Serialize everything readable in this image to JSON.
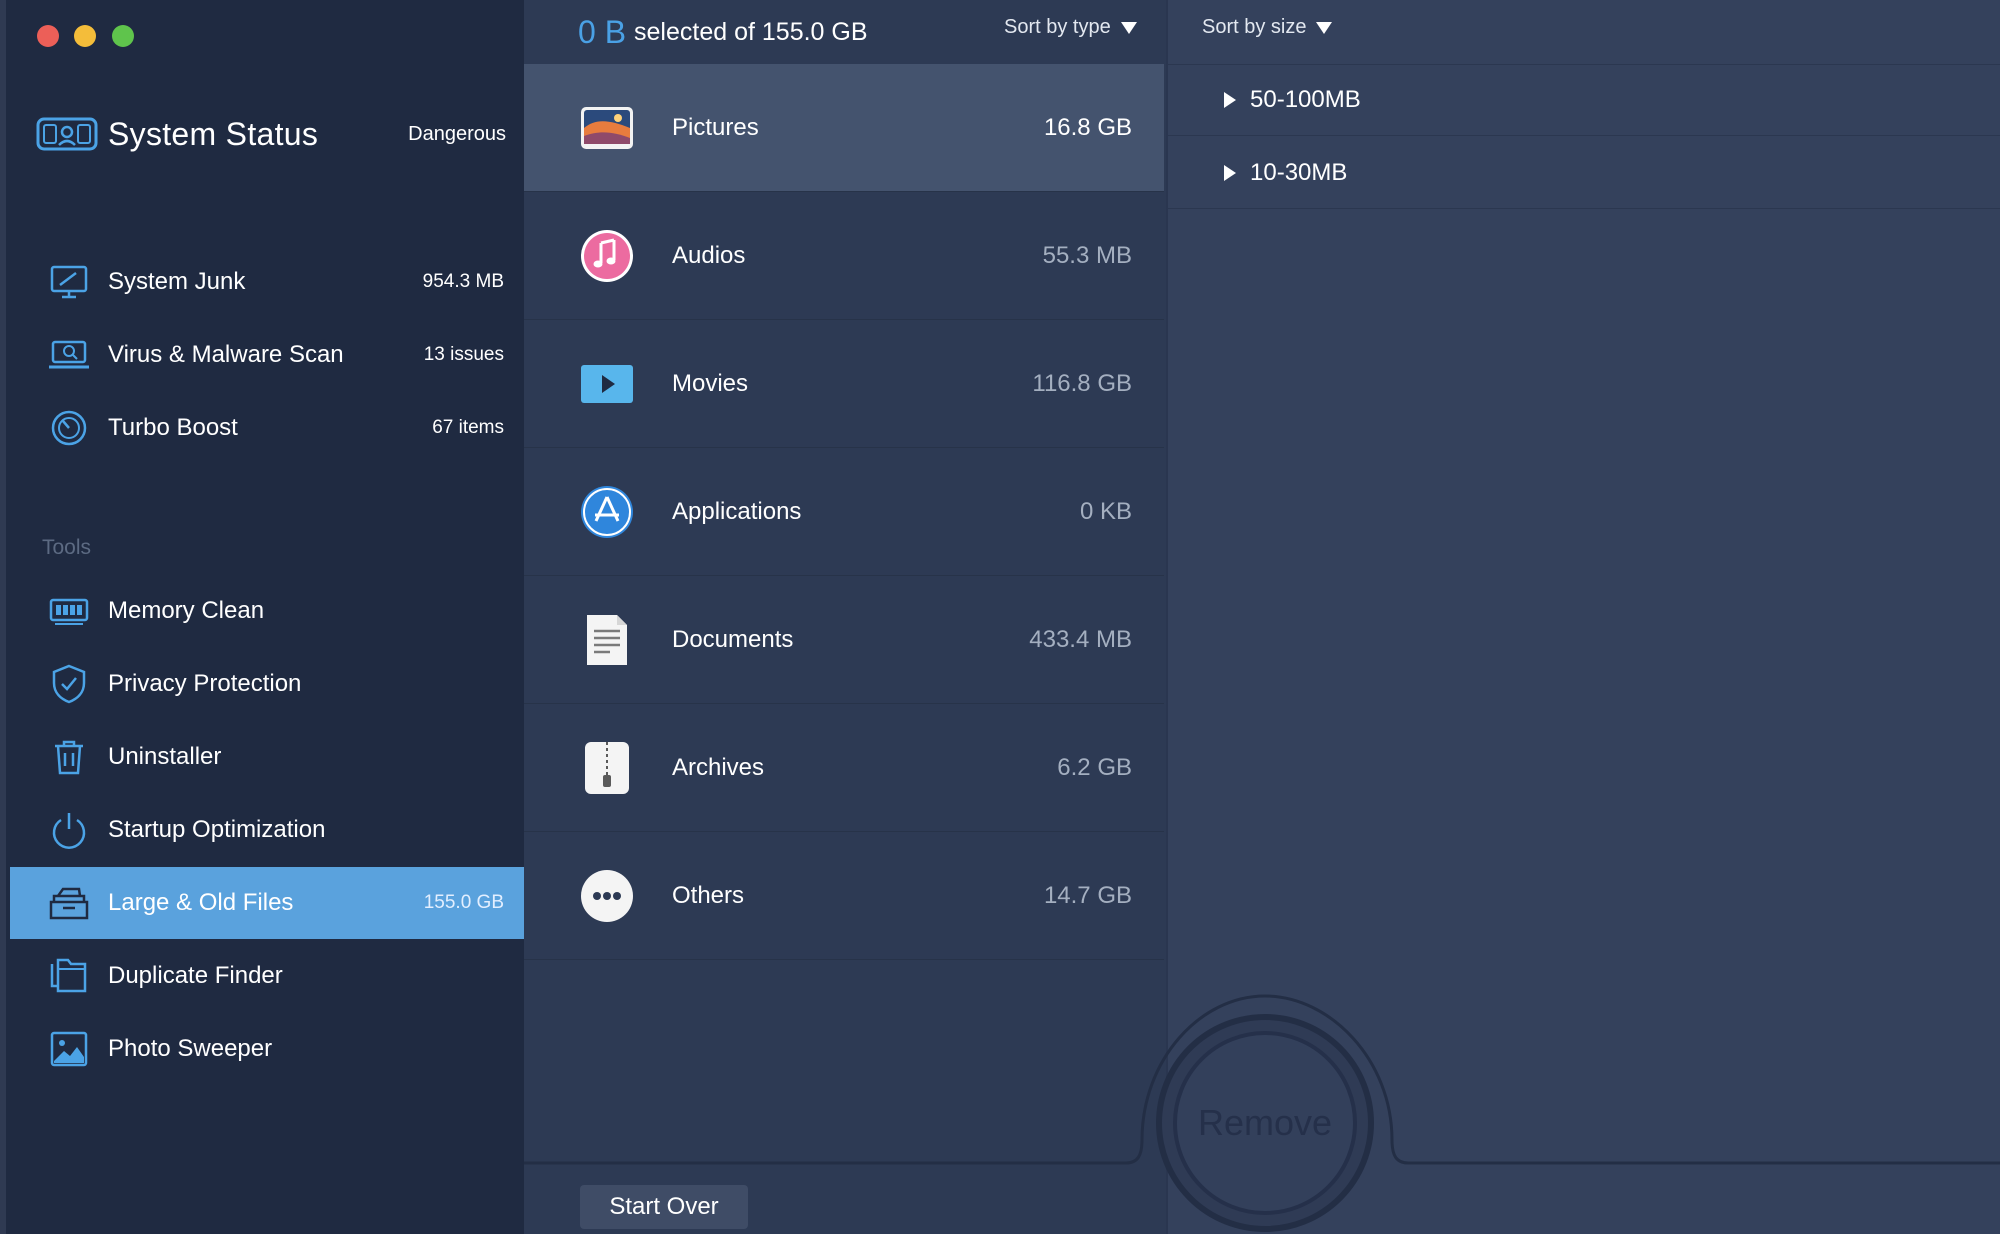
{
  "window": {
    "traffic_lights": [
      "close",
      "minimize",
      "zoom"
    ]
  },
  "sidebar": {
    "status": {
      "title": "System Status",
      "value": "Dangerous",
      "icon": "system-status-icon"
    },
    "items": [
      {
        "label": "System Junk",
        "value": "954.3 MB",
        "icon": "monitor-icon"
      },
      {
        "label": "Virus & Malware Scan",
        "value": "13 issues",
        "icon": "laptop-scan-icon"
      },
      {
        "label": "Turbo Boost",
        "value": "67 items",
        "icon": "speedometer-icon"
      }
    ],
    "tools_header": "Tools",
    "tools": [
      {
        "label": "Memory Clean",
        "value": "",
        "icon": "memory-icon"
      },
      {
        "label": "Privacy Protection",
        "value": "",
        "icon": "shield-icon"
      },
      {
        "label": "Uninstaller",
        "value": "",
        "icon": "trash-icon"
      },
      {
        "label": "Startup Optimization",
        "value": "",
        "icon": "power-icon"
      },
      {
        "label": "Large & Old Files",
        "value": "155.0 GB",
        "icon": "file-box-icon",
        "active": true
      },
      {
        "label": "Duplicate Finder",
        "value": "",
        "icon": "duplicate-icon"
      },
      {
        "label": "Photo Sweeper",
        "value": "",
        "icon": "photo-icon"
      }
    ]
  },
  "middle": {
    "selected_amount": "0 B",
    "selected_text": "selected of 155.0 GB",
    "sort_type_label": "Sort by type",
    "categories": [
      {
        "label": "Pictures",
        "size": "16.8 GB",
        "icon": "pictures-icon",
        "active": true
      },
      {
        "label": "Audios",
        "size": "55.3 MB",
        "icon": "music-icon"
      },
      {
        "label": "Movies",
        "size": "116.8 GB",
        "icon": "play-icon"
      },
      {
        "label": "Applications",
        "size": "0 KB",
        "icon": "app-store-icon"
      },
      {
        "label": "Documents",
        "size": "433.4 MB",
        "icon": "document-icon"
      },
      {
        "label": "Archives",
        "size": "6.2 GB",
        "icon": "zip-icon"
      },
      {
        "label": "Others",
        "size": "14.7 GB",
        "icon": "more-icon"
      }
    ],
    "start_over_label": "Start Over"
  },
  "right": {
    "sort_size_label": "Sort by size",
    "groups": [
      {
        "label": "50-100MB"
      },
      {
        "label": "10-30MB"
      }
    ],
    "remove_label": "Remove"
  },
  "colors": {
    "accent": "#5aa2dd",
    "selected_amount": "#4aa1e6",
    "sidebar_bg": "#1f2a41",
    "middle_bg": "#2d3a54",
    "right_bg": "#34415c"
  }
}
